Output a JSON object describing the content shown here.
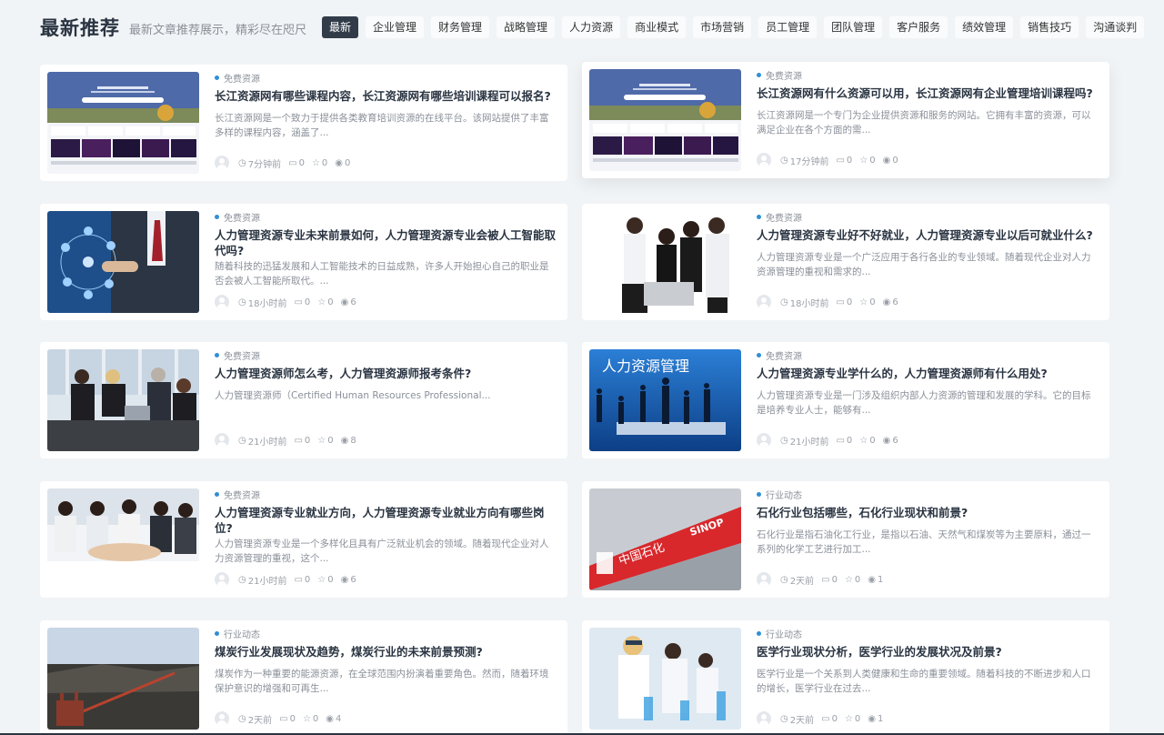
{
  "section": {
    "title": "最新推荐",
    "subtitle": "最新文章推荐展示，精彩尽在咫尺"
  },
  "tabs": [
    {
      "label": "最新",
      "active": true
    },
    {
      "label": "企业管理"
    },
    {
      "label": "财务管理"
    },
    {
      "label": "战略管理"
    },
    {
      "label": "人力资源"
    },
    {
      "label": "商业模式"
    },
    {
      "label": "市场营销"
    },
    {
      "label": "员工管理"
    },
    {
      "label": "团队管理"
    },
    {
      "label": "客户服务"
    },
    {
      "label": "绩效管理"
    },
    {
      "label": "销售技巧"
    },
    {
      "label": "沟通谈判"
    }
  ],
  "icons": {
    "time": "clock-icon",
    "comment": "comment-icon",
    "star": "star-icon",
    "views": "eye-icon"
  },
  "thumb_overlay_text": "人力资源管理",
  "articles": [
    {
      "category": "免费资源",
      "title": "长江资源网有哪些课程内容，长江资源网有哪些培训课程可以报名?",
      "excerpt": "长江资源网是一个致力于提供各类教育培训资源的在线平台。该网站提供了丰富多样的课程内容，涵盖了...",
      "time": "7分钟前",
      "comments": "0",
      "stars": "0",
      "views": "0"
    },
    {
      "category": "免费资源",
      "title": "长江资源网有什么资源可以用，长江资源网有企业管理培训课程吗?",
      "excerpt": "长江资源网是一个专门为企业提供资源和服务的网站。它拥有丰富的资源，可以满足企业在各个方面的需...",
      "time": "17分钟前",
      "comments": "0",
      "stars": "0",
      "views": "0"
    },
    {
      "category": "免费资源",
      "title": "人力管理资源专业未来前景如何，人力管理资源专业会被人工智能取代吗?",
      "excerpt": "随着科技的迅猛发展和人工智能技术的日益成熟，许多人开始担心自己的职业是否会被人工智能所取代。...",
      "time": "18小时前",
      "comments": "0",
      "stars": "0",
      "views": "6"
    },
    {
      "category": "免费资源",
      "title": "人力管理资源专业好不好就业，人力管理资源专业以后可就业什么?",
      "excerpt": "人力管理资源专业是一个广泛应用于各行各业的专业领域。随着现代企业对人力资源管理的重视和需求的...",
      "time": "18小时前",
      "comments": "0",
      "stars": "0",
      "views": "6"
    },
    {
      "category": "免费资源",
      "title": "人力管理资源师怎么考，人力管理资源师报考条件?",
      "excerpt": "人力管理资源师（Certified Human Resources Professional...",
      "time": "21小时前",
      "comments": "0",
      "stars": "0",
      "views": "8"
    },
    {
      "category": "免费资源",
      "title": "人力管理资源专业学什么的，人力管理资源师有什么用处?",
      "excerpt": "人力管理资源专业是一门涉及组织内部人力资源的管理和发展的学科。它的目标是培养专业人士，能够有...",
      "time": "21小时前",
      "comments": "0",
      "stars": "0",
      "views": "6"
    },
    {
      "category": "免费资源",
      "title": "人力管理资源专业就业方向，人力管理资源专业就业方向有哪些岗位?",
      "excerpt": "人力管理资源专业是一个多样化且具有广泛就业机会的领域。随着现代企业对人力资源管理的重视，这个...",
      "time": "21小时前",
      "comments": "0",
      "stars": "0",
      "views": "6"
    },
    {
      "category": "行业动态",
      "title": "石化行业包括哪些，石化行业现状和前景?",
      "excerpt": "石化行业是指石油化工行业，是指以石油、天然气和煤炭等为主要原料，通过一系列的化学工艺进行加工...",
      "time": "2天前",
      "comments": "0",
      "stars": "0",
      "views": "1"
    },
    {
      "category": "行业动态",
      "title": "煤炭行业发展现状及趋势，煤炭行业的未来前景预测?",
      "excerpt": "煤炭作为一种重要的能源资源，在全球范围内扮演着重要角色。然而，随着环境保护意识的增强和可再生...",
      "time": "2天前",
      "comments": "0",
      "stars": "0",
      "views": "4"
    },
    {
      "category": "行业动态",
      "title": "医学行业现状分析，医学行业的发展状况及前景?",
      "excerpt": "医学行业是一个关系到人类健康和生命的重要领域。随着科技的不断进步和人口的增长，医学行业在过去...",
      "time": "2天前",
      "comments": "0",
      "stars": "0",
      "views": "1"
    }
  ]
}
